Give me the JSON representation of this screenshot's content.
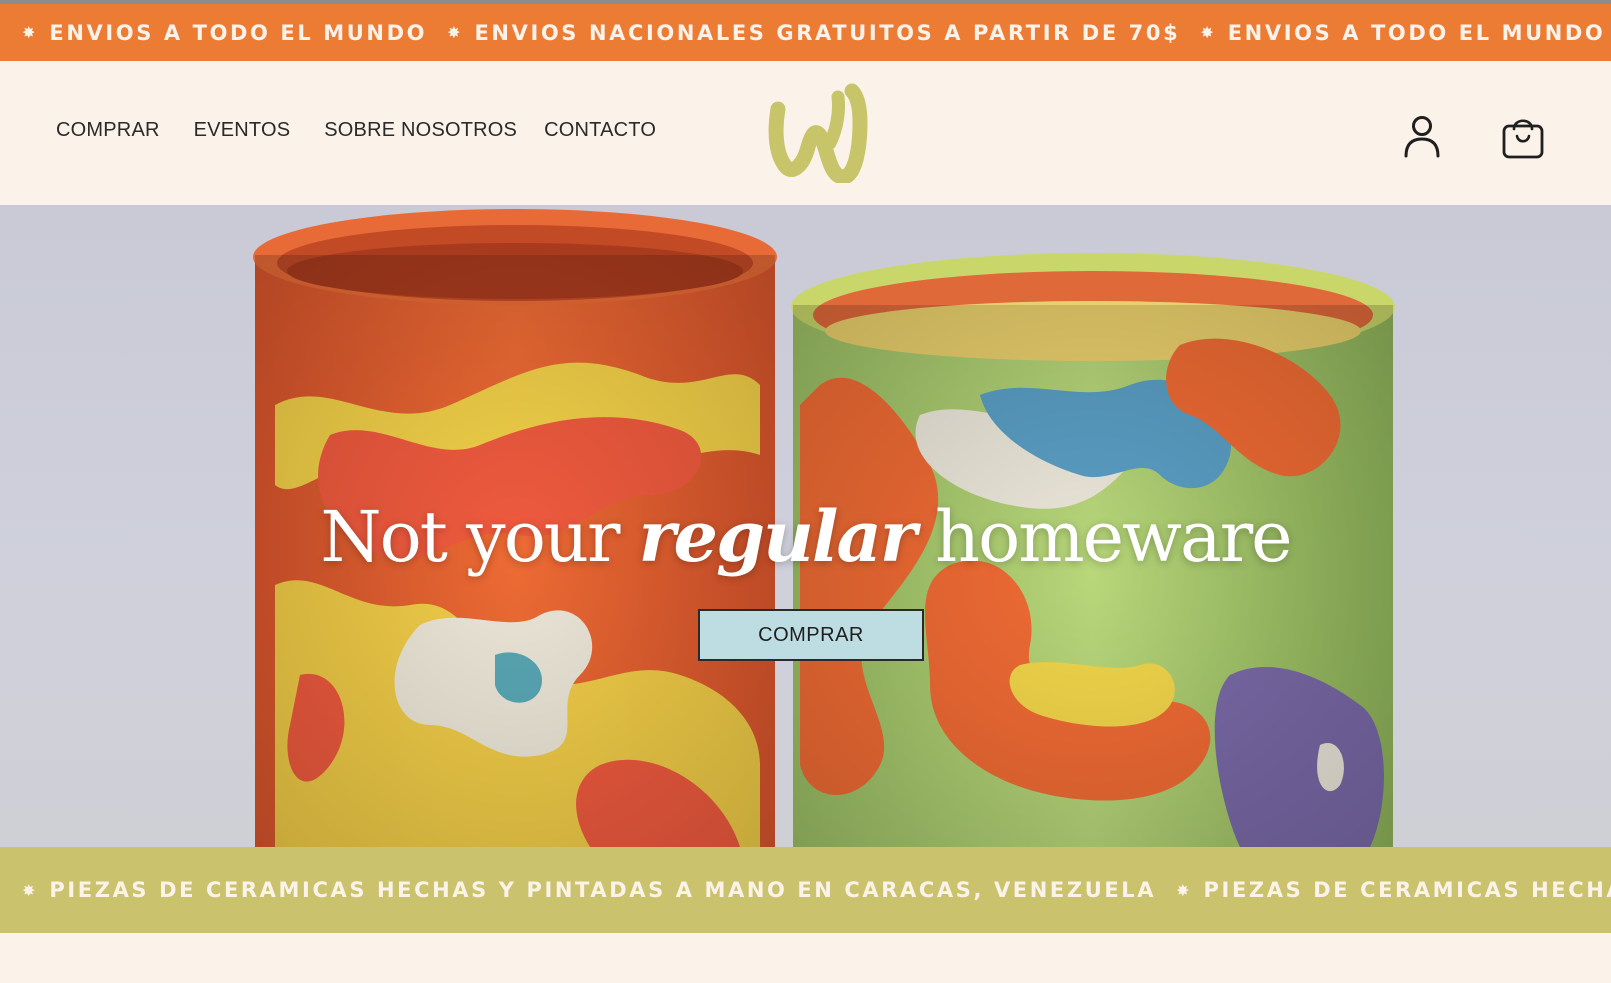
{
  "announcement": {
    "items": [
      "ENVIOS A TODO EL MUNDO",
      "ENVIOS NACIONALES GRATUITOS A PARTIR DE 70$",
      "ENVIOS A TODO EL MUNDO"
    ],
    "separator": "✸",
    "background": "#ec7b34"
  },
  "nav": {
    "items": [
      {
        "label": "COMPRAR"
      },
      {
        "label": "EVENTOS"
      },
      {
        "label": "SOBRE NOSOTROS"
      },
      {
        "label": "CONTACTO"
      }
    ]
  },
  "header": {
    "logo_icon": "w-logo-icon",
    "logo_color": "#c8c46a",
    "account_icon": "user-icon",
    "cart_icon": "shopping-bag-icon"
  },
  "hero": {
    "headline_pre": "Not your ",
    "headline_em": "regular",
    "headline_post": " homeware",
    "cta_label": "COMPRAR"
  },
  "ticker": {
    "items": [
      "PIEZAS DE CERAMICAS HECHAS Y PINTADAS A MANO EN CARACAS, VENEZUELA",
      "PIEZAS DE CERAMICAS HECHAS Y PINTA"
    ],
    "separator": "✸",
    "background": "#cbc26d"
  }
}
